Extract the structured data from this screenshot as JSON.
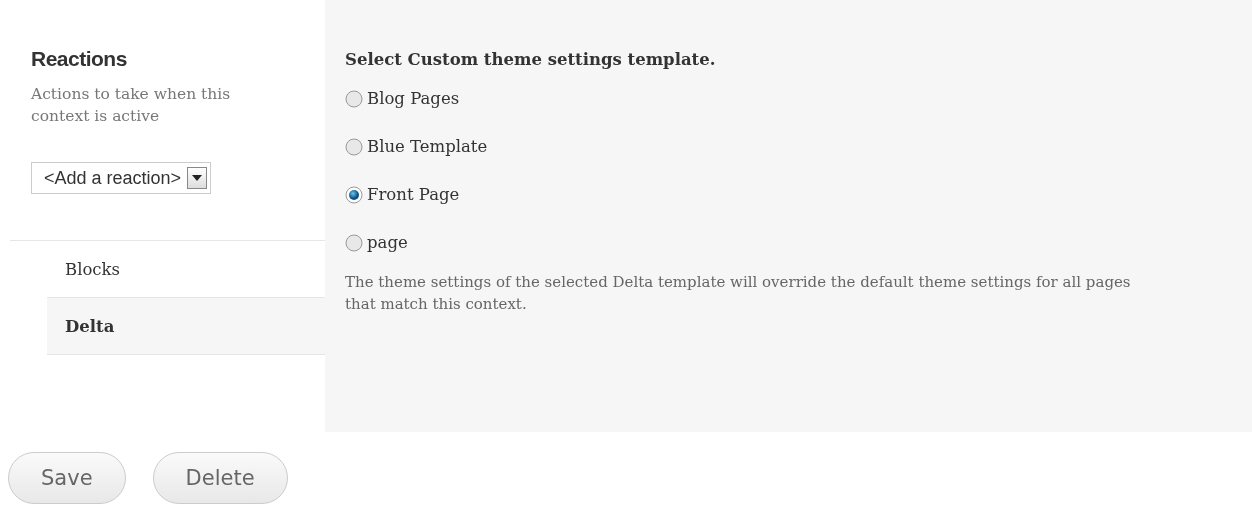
{
  "reactions": {
    "title": "Reactions",
    "description": "Actions to take when this context is active",
    "select": {
      "value": "<Add a reaction>"
    }
  },
  "tabs": [
    {
      "label": "Blocks",
      "selected": false
    },
    {
      "label": "Delta",
      "selected": true
    }
  ],
  "panel": {
    "heading": "Select Custom theme settings template.",
    "options": [
      {
        "label": "Blog Pages",
        "selected": false
      },
      {
        "label": "Blue Template",
        "selected": false
      },
      {
        "label": "Front Page",
        "selected": true
      },
      {
        "label": "page",
        "selected": false
      }
    ],
    "description": "The theme settings of the selected Delta template will override the default theme settings for all pages that match this context."
  },
  "buttons": [
    "Save",
    "Delete"
  ]
}
